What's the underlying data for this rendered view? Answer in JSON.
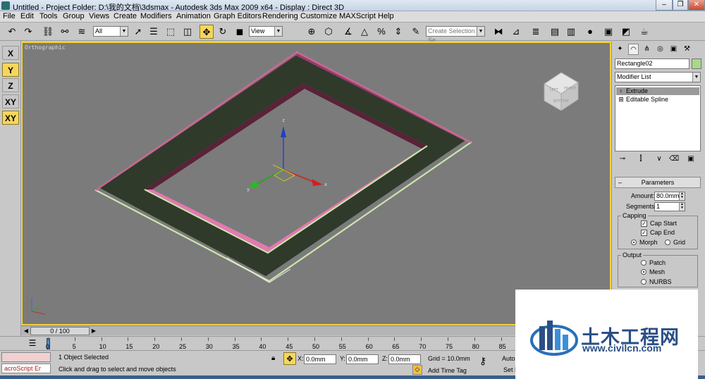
{
  "window": {
    "title": "Untitled    - Project Folder: D:\\我的文档\\3dsmax    - Autodesk 3ds Max  2009 x64    - Display : Direct 3D",
    "min": "–",
    "max": "❐",
    "close": "✕"
  },
  "menu": [
    "File",
    "Edit",
    "Tools",
    "Group",
    "Views",
    "Create",
    "Modifiers",
    "Animation",
    "Graph Editors",
    "Rendering",
    "Customize",
    "MAXScript",
    "Help"
  ],
  "toolbar": {
    "selection_filter": "All",
    "ref_coord": "View",
    "named_selection_placeholder": "Create Selection Se"
  },
  "axis_constraints": [
    "X",
    "Y",
    "Z",
    "XY",
    "XY"
  ],
  "viewport": {
    "label": "Orthographic",
    "viewcube_labels": [
      "LEFT",
      "FRONT",
      "BOTTOM"
    ]
  },
  "command_panel": {
    "object_name": "Rectangle02",
    "modifier_list": "Modifier List",
    "stack": [
      "Extrude",
      "Editable Spline"
    ],
    "parameters_title": "Parameters",
    "amount_label": "Amount:",
    "amount_value": "80.0mm",
    "segments_label": "Segments:",
    "segments_value": "1",
    "capping_title": "Capping",
    "cap_start": "Cap Start",
    "cap_end": "Cap End",
    "morph": "Morph",
    "grid": "Grid",
    "output_title": "Output",
    "patch": "Patch",
    "mesh": "Mesh",
    "nurbs": "NURBS"
  },
  "time": {
    "slider_label": "0 / 100",
    "ticks": [
      "0",
      "5",
      "10",
      "15",
      "20",
      "25",
      "30",
      "35",
      "40",
      "45",
      "50",
      "55",
      "60",
      "65",
      "70",
      "75",
      "80",
      "85"
    ]
  },
  "status": {
    "maxscript_listener": "acroScript Er",
    "selection_info": "1 Object Selected",
    "prompt": "Click and drag to select and move objects",
    "x_label": "X:",
    "x_value": "0.0mm",
    "y_label": "Y:",
    "y_value": "0.0mm",
    "z_label": "Z:",
    "z_value": "0.0mm",
    "grid": "Grid = 10.0mm",
    "add_time_tag": "Add Time Tag",
    "auto_key": "Auto",
    "set_key": "Set K"
  },
  "watermark": {
    "text": "土木工程网",
    "url": "www.civilcn.com"
  }
}
